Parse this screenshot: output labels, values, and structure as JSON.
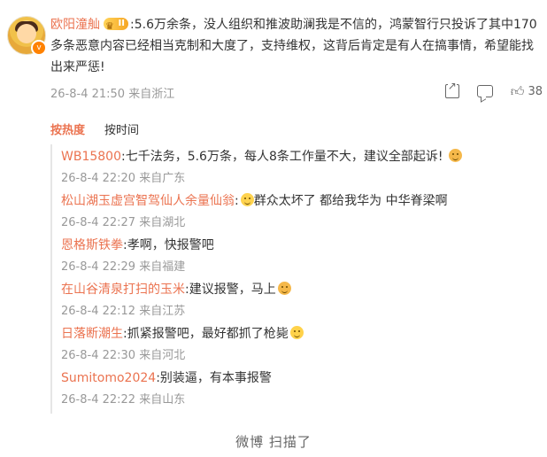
{
  "main_comment": {
    "username": "欧阳潼舢",
    "text": ":5.6万余条，没人组织和推波助澜我是不信的，鸿蒙智行只投诉了其中170多条恶意内容已经相当克制和大度了，支持维权，这背后肯定是有人在搞事情，希望能找出来严惩!",
    "timestamp": "26-8-4 21:50 来自浙江",
    "like_count": "38",
    "icons": {
      "share": "share-icon",
      "comment": "comment-icon",
      "like": "thumbs-up-icon"
    }
  },
  "sort_tabs": {
    "hot": "按热度",
    "time": "按时间"
  },
  "replies": [
    {
      "name": "WB15800",
      "text": ":七千法务，5.6万条，每人8条工作量不大，建议全部起诉!",
      "emoji": "cat-emoji",
      "meta": "26-8-4 22:20 来自广东"
    },
    {
      "name": "松山湖玉虚宫智驾仙人余量仙翁",
      "text": "群众太坏了 都给我华为 中华脊梁啊",
      "emoji_before": "sweat-emoji",
      "meta": "26-8-4 22:27 来自湖北"
    },
    {
      "name": "恩格斯铁拳",
      "text": ":孝啊，快报警吧",
      "meta": "26-8-4 22:29 来自福建"
    },
    {
      "name": "在山谷清泉打扫的玉米",
      "text": ":建议报警，马上",
      "emoji": "cat-emoji",
      "meta": "26-8-4 22:12 来自江苏"
    },
    {
      "name": "日落断潮生",
      "text": ":抓紧报警吧，最好都抓了枪毙",
      "emoji": "laugh-emoji",
      "meta": "26-8-4 22:30 来自河北"
    },
    {
      "name": "Sumitomo2024",
      "text": ":别装逼，有本事报警",
      "meta": "26-8-4 22:22 来自山东"
    }
  ],
  "footer_text": "微博 扫描了"
}
